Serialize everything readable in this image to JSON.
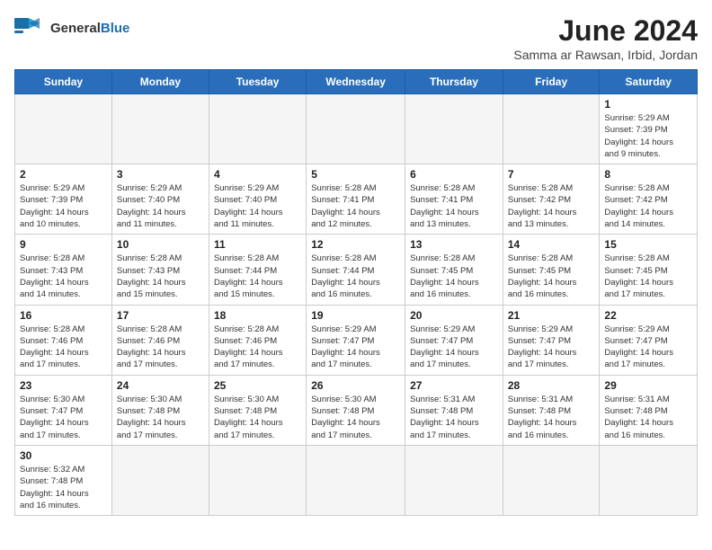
{
  "header": {
    "logo_general": "General",
    "logo_blue": "Blue",
    "month_title": "June 2024",
    "subtitle": "Samma ar Rawsan, Irbid, Jordan"
  },
  "days_of_week": [
    "Sunday",
    "Monday",
    "Tuesday",
    "Wednesday",
    "Thursday",
    "Friday",
    "Saturday"
  ],
  "weeks": [
    [
      {
        "day": "",
        "info": ""
      },
      {
        "day": "",
        "info": ""
      },
      {
        "day": "",
        "info": ""
      },
      {
        "day": "",
        "info": ""
      },
      {
        "day": "",
        "info": ""
      },
      {
        "day": "",
        "info": ""
      },
      {
        "day": "1",
        "info": "Sunrise: 5:29 AM\nSunset: 7:39 PM\nDaylight: 14 hours\nand 9 minutes."
      }
    ],
    [
      {
        "day": "2",
        "info": "Sunrise: 5:29 AM\nSunset: 7:39 PM\nDaylight: 14 hours\nand 10 minutes."
      },
      {
        "day": "3",
        "info": "Sunrise: 5:29 AM\nSunset: 7:40 PM\nDaylight: 14 hours\nand 11 minutes."
      },
      {
        "day": "4",
        "info": "Sunrise: 5:29 AM\nSunset: 7:40 PM\nDaylight: 14 hours\nand 11 minutes."
      },
      {
        "day": "5",
        "info": "Sunrise: 5:28 AM\nSunset: 7:41 PM\nDaylight: 14 hours\nand 12 minutes."
      },
      {
        "day": "6",
        "info": "Sunrise: 5:28 AM\nSunset: 7:41 PM\nDaylight: 14 hours\nand 13 minutes."
      },
      {
        "day": "7",
        "info": "Sunrise: 5:28 AM\nSunset: 7:42 PM\nDaylight: 14 hours\nand 13 minutes."
      },
      {
        "day": "8",
        "info": "Sunrise: 5:28 AM\nSunset: 7:42 PM\nDaylight: 14 hours\nand 14 minutes."
      }
    ],
    [
      {
        "day": "9",
        "info": "Sunrise: 5:28 AM\nSunset: 7:43 PM\nDaylight: 14 hours\nand 14 minutes."
      },
      {
        "day": "10",
        "info": "Sunrise: 5:28 AM\nSunset: 7:43 PM\nDaylight: 14 hours\nand 15 minutes."
      },
      {
        "day": "11",
        "info": "Sunrise: 5:28 AM\nSunset: 7:44 PM\nDaylight: 14 hours\nand 15 minutes."
      },
      {
        "day": "12",
        "info": "Sunrise: 5:28 AM\nSunset: 7:44 PM\nDaylight: 14 hours\nand 16 minutes."
      },
      {
        "day": "13",
        "info": "Sunrise: 5:28 AM\nSunset: 7:45 PM\nDaylight: 14 hours\nand 16 minutes."
      },
      {
        "day": "14",
        "info": "Sunrise: 5:28 AM\nSunset: 7:45 PM\nDaylight: 14 hours\nand 16 minutes."
      },
      {
        "day": "15",
        "info": "Sunrise: 5:28 AM\nSunset: 7:45 PM\nDaylight: 14 hours\nand 17 minutes."
      }
    ],
    [
      {
        "day": "16",
        "info": "Sunrise: 5:28 AM\nSunset: 7:46 PM\nDaylight: 14 hours\nand 17 minutes."
      },
      {
        "day": "17",
        "info": "Sunrise: 5:28 AM\nSunset: 7:46 PM\nDaylight: 14 hours\nand 17 minutes."
      },
      {
        "day": "18",
        "info": "Sunrise: 5:28 AM\nSunset: 7:46 PM\nDaylight: 14 hours\nand 17 minutes."
      },
      {
        "day": "19",
        "info": "Sunrise: 5:29 AM\nSunset: 7:47 PM\nDaylight: 14 hours\nand 17 minutes."
      },
      {
        "day": "20",
        "info": "Sunrise: 5:29 AM\nSunset: 7:47 PM\nDaylight: 14 hours\nand 17 minutes."
      },
      {
        "day": "21",
        "info": "Sunrise: 5:29 AM\nSunset: 7:47 PM\nDaylight: 14 hours\nand 17 minutes."
      },
      {
        "day": "22",
        "info": "Sunrise: 5:29 AM\nSunset: 7:47 PM\nDaylight: 14 hours\nand 17 minutes."
      }
    ],
    [
      {
        "day": "23",
        "info": "Sunrise: 5:30 AM\nSunset: 7:47 PM\nDaylight: 14 hours\nand 17 minutes."
      },
      {
        "day": "24",
        "info": "Sunrise: 5:30 AM\nSunset: 7:48 PM\nDaylight: 14 hours\nand 17 minutes."
      },
      {
        "day": "25",
        "info": "Sunrise: 5:30 AM\nSunset: 7:48 PM\nDaylight: 14 hours\nand 17 minutes."
      },
      {
        "day": "26",
        "info": "Sunrise: 5:30 AM\nSunset: 7:48 PM\nDaylight: 14 hours\nand 17 minutes."
      },
      {
        "day": "27",
        "info": "Sunrise: 5:31 AM\nSunset: 7:48 PM\nDaylight: 14 hours\nand 17 minutes."
      },
      {
        "day": "28",
        "info": "Sunrise: 5:31 AM\nSunset: 7:48 PM\nDaylight: 14 hours\nand 16 minutes."
      },
      {
        "day": "29",
        "info": "Sunrise: 5:31 AM\nSunset: 7:48 PM\nDaylight: 14 hours\nand 16 minutes."
      }
    ],
    [
      {
        "day": "30",
        "info": "Sunrise: 5:32 AM\nSunset: 7:48 PM\nDaylight: 14 hours\nand 16 minutes."
      },
      {
        "day": "",
        "info": ""
      },
      {
        "day": "",
        "info": ""
      },
      {
        "day": "",
        "info": ""
      },
      {
        "day": "",
        "info": ""
      },
      {
        "day": "",
        "info": ""
      },
      {
        "day": "",
        "info": ""
      }
    ]
  ]
}
